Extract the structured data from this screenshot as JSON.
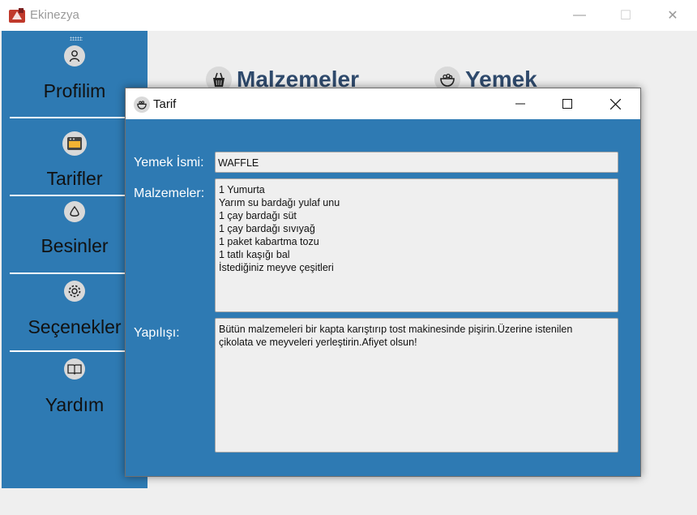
{
  "app": {
    "title": "Ekinezya",
    "minimize": "—",
    "maximize": "☐",
    "close": "✕"
  },
  "sidebar": {
    "items": [
      {
        "label": "Profilim",
        "icon": "user-icon"
      },
      {
        "label": "Tarifler",
        "icon": "oven-icon"
      },
      {
        "label": "Besinler",
        "icon": "food-icon"
      },
      {
        "label": "Seçenekler",
        "icon": "gear-icon"
      },
      {
        "label": "Yardım",
        "icon": "book-icon"
      }
    ]
  },
  "content": {
    "tabs": [
      {
        "label": "Malzemeler",
        "icon": "basket-icon"
      },
      {
        "label": "Yemek",
        "icon": "bowl-icon"
      }
    ]
  },
  "dialog": {
    "title": "Tarif",
    "name_label": "Yemek İsmi:",
    "name_value": "WAFFLE",
    "ingredients_label": "Malzemeler:",
    "ingredients": [
      "1 Yumurta",
      "Yarım su bardağı yulaf unu",
      "1 çay bardağı süt",
      "1 çay bardağı sıvıyağ",
      "1 paket kabartma tozu",
      "1 tatlı kaşığı bal",
      "İstediğiniz meyve çeşitleri"
    ],
    "instructions_label": "Yapılışı:",
    "instructions": [
      "Bütün malzemeleri bir kapta karıştırıp tost makinesinde pişirin.Üzerine istenilen",
      "çikolata ve meyveleri yerleştirin.Afiyet olsun!"
    ]
  },
  "colors": {
    "sidebar": "#2e7ab3",
    "dialog": "#2e7ab3",
    "header_text": "#2f4a6c"
  }
}
